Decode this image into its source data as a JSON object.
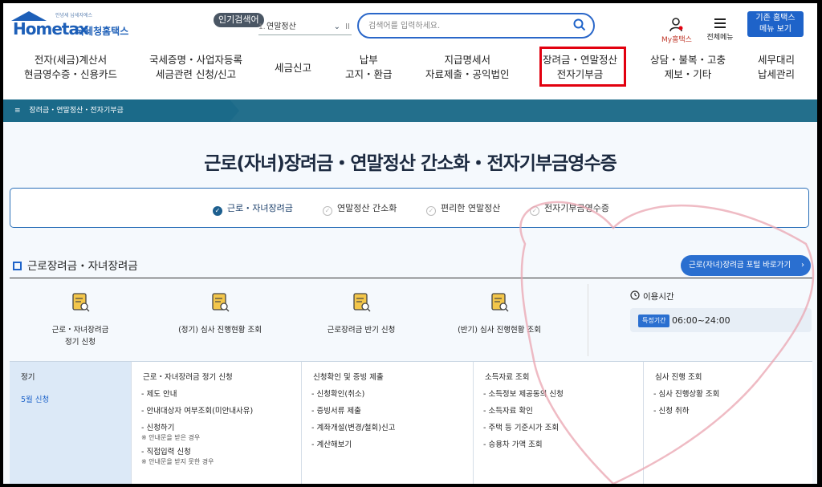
{
  "header": {
    "logo_text": "Hometax",
    "logo_sub": "국세청홈택스",
    "logo_slogan": "안녕세 납세자에스",
    "popular_label": "인기검색어",
    "popular_index": "1.",
    "popular_value": "연말정산",
    "popular_pause": "II",
    "search_placeholder": "검색어를 입력하세요.",
    "myhome_label": "My홈택스",
    "allmenu_label": "전체메뉴",
    "oldhome_line1": "기존 홈택스",
    "oldhome_line2": "메뉴 보기"
  },
  "nav": [
    {
      "line1": "전자(세금)계산서",
      "line2": "현금영수증・신용카드"
    },
    {
      "line1": "국세증명・사업자등록",
      "line2": "세금관련 신청/신고"
    },
    {
      "line1": "세금신고",
      "line2": ""
    },
    {
      "line1": "납부",
      "line2": "고지・환급"
    },
    {
      "line1": "지급명세서",
      "line2": "자료제출・공익법인"
    },
    {
      "line1": "장려금・연말정산",
      "line2": "전자기부금"
    },
    {
      "line1": "상담・불복・고충",
      "line2": "제보・기타"
    },
    {
      "line1": "세무대리",
      "line2": "납세관리"
    }
  ],
  "breadcrumb": {
    "menu_icon": "≡",
    "label": "장려금・연말정산・전자기부금"
  },
  "page_title": "근로(자녀)장려금・연말정산 간소화・전자기부금영수증",
  "tabs": [
    {
      "label": "근로・자녀장려금",
      "active": true
    },
    {
      "label": "연말정산 간소화",
      "active": false
    },
    {
      "label": "편리한 연말정산",
      "active": false
    },
    {
      "label": "전자기부금영수증",
      "active": false
    }
  ],
  "section": {
    "title": "근로장려금・자녀장려금",
    "portal_button": "근로(자녀)장려금 포털 바로가기",
    "portal_arrow": "›"
  },
  "services": [
    {
      "line1": "근로・자녀장려금",
      "line2": "정기 신청"
    },
    {
      "line1": "(정기) 심사 진행현황 조회",
      "line2": ""
    },
    {
      "line1": "근로장려금 반기 신청",
      "line2": ""
    },
    {
      "line1": "(반기) 심사 진행현황 조회",
      "line2": ""
    }
  ],
  "usage": {
    "label": "이용시간",
    "badge": "특정기간",
    "time": "06:00~24:00"
  },
  "grid": {
    "col1": {
      "head": "정기",
      "sub": "5월 신청"
    },
    "col2": {
      "head": "근로・자녀장려금 정기 신청",
      "items": [
        "- 제도 안내",
        "- 안내대상자 여부조회(미안내사유)",
        "- 신청하기",
        "- 직접입력 신청"
      ],
      "note1": "※ 안내문을 받은 경우",
      "note2": "※ 안내문을 받지 못한 경우"
    },
    "col3": {
      "head": "신청확인 및 증빙 제출",
      "items": [
        "- 신청확인(취소)",
        "- 증빙서류 제출",
        "- 계좌개설(변경/철회)신고",
        "- 계산해보기"
      ]
    },
    "col4": {
      "head": "소득자료 조회",
      "items": [
        "- 소득정보 제공동의 신청",
        "- 소득자료 확인",
        "- 주택 등 기준시가 조회",
        "- 승용차 가액 조회"
      ]
    },
    "col5": {
      "head": "심사 진행 조회",
      "items": [
        "- 심사 진행상황 조회",
        "- 신청 취하"
      ]
    }
  },
  "colors": {
    "accent": "#1e63c9",
    "subbar": "#236f8c",
    "highlight": "#e2000f"
  }
}
